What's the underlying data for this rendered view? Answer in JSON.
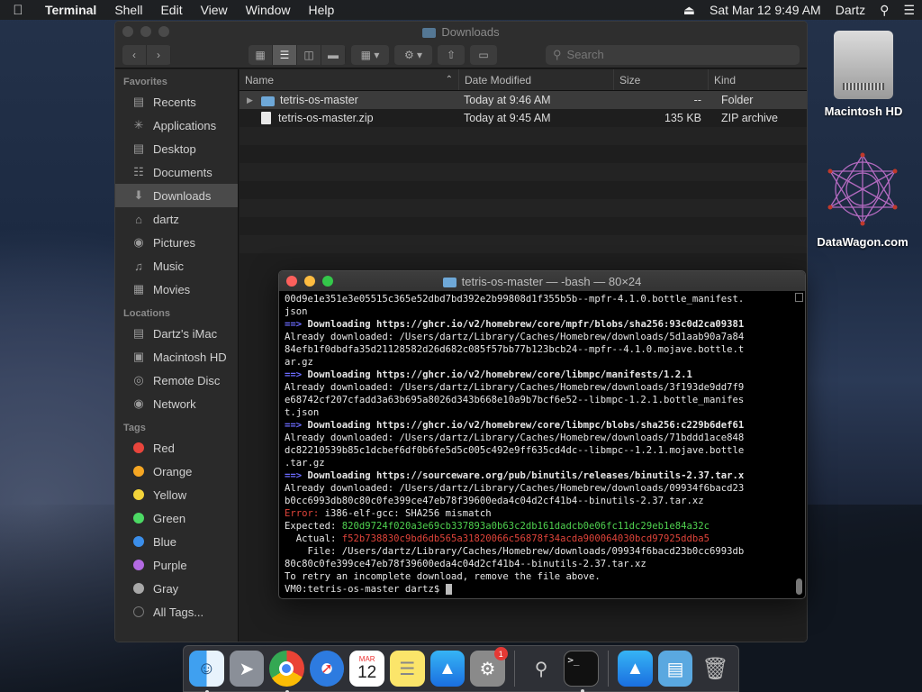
{
  "menubar": {
    "app": "Terminal",
    "items": [
      "Shell",
      "Edit",
      "View",
      "Window",
      "Help"
    ],
    "datetime": "Sat Mar 12  9:49 AM",
    "user": "Dartz"
  },
  "finder": {
    "title": "Downloads",
    "search_placeholder": "Search",
    "sidebar": {
      "favorites_head": "Favorites",
      "favorites": [
        "Recents",
        "Applications",
        "Desktop",
        "Documents",
        "Downloads",
        "dartz",
        "Pictures",
        "Music",
        "Movies"
      ],
      "locations_head": "Locations",
      "locations": [
        "Dartz's iMac",
        "Macintosh HD",
        "Remote Disc",
        "Network"
      ],
      "tags_head": "Tags",
      "tags": [
        {
          "label": "Red",
          "color": "#e8453c"
        },
        {
          "label": "Orange",
          "color": "#f5a623"
        },
        {
          "label": "Yellow",
          "color": "#f3d33a"
        },
        {
          "label": "Green",
          "color": "#4cd964"
        },
        {
          "label": "Blue",
          "color": "#3b8eea"
        },
        {
          "label": "Purple",
          "color": "#b36ae2"
        },
        {
          "label": "Gray",
          "color": "#a8a8a8"
        }
      ],
      "all_tags": "All Tags..."
    },
    "columns": {
      "name": "Name",
      "date": "Date Modified",
      "size": "Size",
      "kind": "Kind"
    },
    "files": [
      {
        "name": "tetris-os-master",
        "date": "Today at 9:46 AM",
        "size": "--",
        "kind": "Folder"
      },
      {
        "name": "tetris-os-master.zip",
        "date": "Today at 9:45 AM",
        "size": "135 KB",
        "kind": "ZIP archive"
      }
    ]
  },
  "terminal": {
    "title": "tetris-os-master — -bash — 80×24",
    "lines": [
      {
        "parts": [
          {
            "t": "00d9e1e351e3e05515c365e52dbd7bd392e2b99808d1f355b5b--mpfr-4.1.0.bottle_manifest."
          }
        ]
      },
      {
        "parts": [
          {
            "t": "json"
          }
        ]
      },
      {
        "parts": [
          {
            "t": "==> ",
            "c": "arrow"
          },
          {
            "t": "Downloading https://ghcr.io/v2/homebrew/core/mpfr/blobs/sha256:93c0d2ca09381",
            "c": "b"
          }
        ]
      },
      {
        "parts": [
          {
            "t": "Already downloaded: /Users/dartz/Library/Caches/Homebrew/downloads/5d1aab90a7a84"
          }
        ]
      },
      {
        "parts": [
          {
            "t": "84efb1f0dbdfa35d21128582d26d682c085f57bb77b123bcb24--mpfr--4.1.0.mojave.bottle.t"
          }
        ]
      },
      {
        "parts": [
          {
            "t": "ar.gz"
          }
        ]
      },
      {
        "parts": [
          {
            "t": "==> ",
            "c": "arrow"
          },
          {
            "t": "Downloading https://ghcr.io/v2/homebrew/core/libmpc/manifests/1.2.1",
            "c": "b"
          }
        ]
      },
      {
        "parts": [
          {
            "t": "Already downloaded: /Users/dartz/Library/Caches/Homebrew/downloads/3f193de9dd7f9"
          }
        ]
      },
      {
        "parts": [
          {
            "t": "e68742cf207cfadd3a63b695a8026d343b668e10a9b7bcf6e52--libmpc-1.2.1.bottle_manifes"
          }
        ]
      },
      {
        "parts": [
          {
            "t": "t.json"
          }
        ]
      },
      {
        "parts": [
          {
            "t": "==> ",
            "c": "arrow"
          },
          {
            "t": "Downloading https://ghcr.io/v2/homebrew/core/libmpc/blobs/sha256:c229b6def61",
            "c": "b"
          }
        ]
      },
      {
        "parts": [
          {
            "t": "Already downloaded: /Users/dartz/Library/Caches/Homebrew/downloads/71bddd1ace848"
          }
        ]
      },
      {
        "parts": [
          {
            "t": "dc82210539b85c1dcbef6df0b6fe5d5c005c492e9ff635cd4dc--libmpc--1.2.1.mojave.bottle"
          }
        ]
      },
      {
        "parts": [
          {
            "t": ".tar.gz"
          }
        ]
      },
      {
        "parts": [
          {
            "t": "==> ",
            "c": "arrow"
          },
          {
            "t": "Downloading https://sourceware.org/pub/binutils/releases/binutils-2.37.tar.x",
            "c": "b"
          }
        ]
      },
      {
        "parts": [
          {
            "t": "Already downloaded: /Users/dartz/Library/Caches/Homebrew/downloads/09934f6bacd23"
          }
        ]
      },
      {
        "parts": [
          {
            "t": "b0cc6993db80c80c0fe399ce47eb78f39600eda4c04d2cf41b4--binutils-2.37.tar.xz"
          }
        ]
      },
      {
        "parts": [
          {
            "t": "Error: ",
            "c": "err"
          },
          {
            "t": "i386-elf-gcc: SHA256 mismatch"
          }
        ]
      },
      {
        "parts": [
          {
            "t": "Expected: "
          },
          {
            "t": "820d9724f020a3e69cb337893a0b63c2db161dadcb0e06fc11dc29eb1e84a32c",
            "c": "grn"
          }
        ]
      },
      {
        "parts": [
          {
            "t": "  Actual: "
          },
          {
            "t": "f52b738830c9bd6db565a31820066c56878f34acda900064030bcd97925ddba5",
            "c": "red"
          }
        ]
      },
      {
        "parts": [
          {
            "t": "    File: /Users/dartz/Library/Caches/Homebrew/downloads/09934f6bacd23b0cc6993db"
          }
        ]
      },
      {
        "parts": [
          {
            "t": "80c80c0fe399ce47eb78f39600eda4c04d2cf41b4--binutils-2.37.tar.xz"
          }
        ]
      },
      {
        "parts": [
          {
            "t": "To retry an incomplete download, remove the file above."
          }
        ]
      },
      {
        "parts": [
          {
            "t": "VM0:tetris-os-master dartz$ "
          }
        ],
        "cursor": true
      }
    ]
  },
  "desktop": {
    "icons": [
      {
        "label": "Macintosh HD"
      },
      {
        "label": "DataWagon.com"
      }
    ]
  },
  "dock": {
    "calendar_month": "MAR",
    "calendar_day": "12",
    "settings_badge": "1"
  }
}
